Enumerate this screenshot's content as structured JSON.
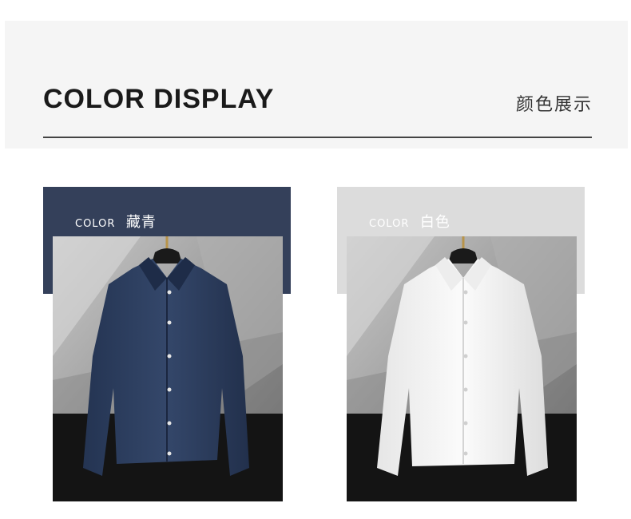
{
  "header": {
    "title": "COLOR DISPLAY",
    "subtitle": "颜色展示"
  },
  "cards": [
    {
      "label": "COLOR",
      "color_name": "藏青",
      "band_color": "#34405a",
      "shirt_color": "#2c3d5c"
    },
    {
      "label": "COLOR",
      "color_name": "白色",
      "band_color": "#dcdcdc",
      "shirt_color": "#f4f4f4"
    }
  ]
}
